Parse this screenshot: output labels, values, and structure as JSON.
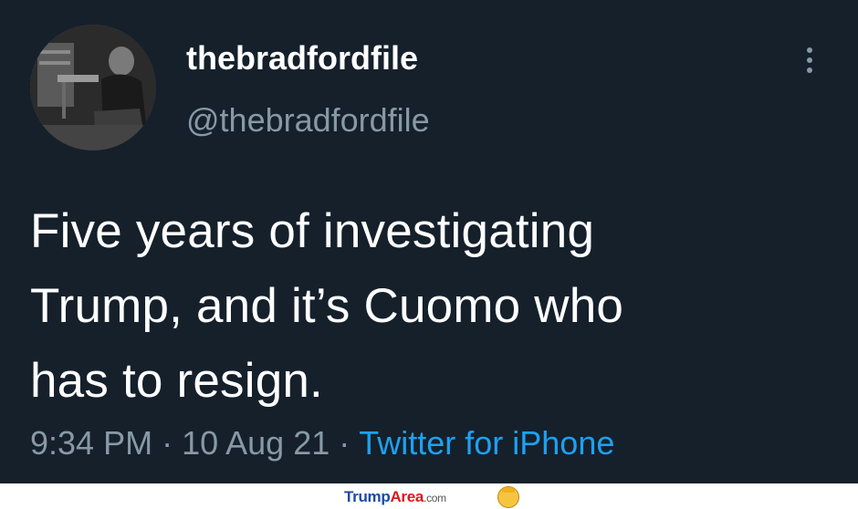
{
  "tweet": {
    "display_name": "thebradfordfile",
    "handle": "@thebradfordfile",
    "text_line1": "Five years of investigating",
    "text_line2": "Trump, and it’s Cuomo who",
    "text_line3": "has to resign.",
    "time": "9:34 PM",
    "separator": "·",
    "date": "10 Aug 21",
    "source": "Twitter for iPhone",
    "more_icon": "more-vertical-icon",
    "avatar_icon": "profile-photo"
  },
  "watermark": {
    "part1": "Trump",
    "part2": "Area",
    "part3": ".com",
    "emoji_icon": "trump-face-icon"
  },
  "colors": {
    "background": "#15202b",
    "text": "#ffffff",
    "secondary": "#8899a6",
    "link": "#1da1f2"
  }
}
